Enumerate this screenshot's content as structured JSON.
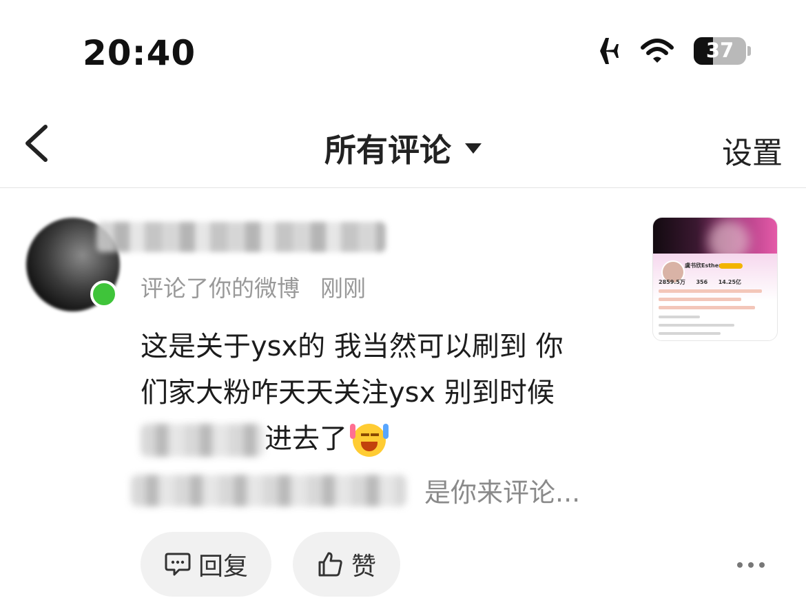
{
  "status_bar": {
    "time": "20:40",
    "battery_level": "37",
    "battery_fraction": 0.37,
    "icons": [
      "airplane-icon",
      "wifi-icon",
      "battery-icon"
    ]
  },
  "nav": {
    "title": "所有评论",
    "settings_label": "设置",
    "icons": [
      "back-chevron-icon",
      "dropdown-caret-icon"
    ]
  },
  "comment": {
    "meta_action": "评论了你的微博",
    "meta_time": "刚刚",
    "body_line1": "这是关于ysx的 我当然可以刷到 你",
    "body_line2": "们家大粉咋天天关注ysx 别到时候",
    "body_line3_tail": "进去了",
    "emoji_name": "laughing-emoji",
    "quote_tail": "是你来评论...",
    "online_color": "#3fc43a"
  },
  "thumbnail": {
    "profile_name": "虞书欣Esther",
    "stat1": "2859.5万",
    "stat2": "356",
    "stat3": "14.25亿"
  },
  "actions": {
    "reply_label": "回复",
    "like_label": "赞",
    "icons": [
      "reply-icon",
      "thumbs-up-icon",
      "more-icon"
    ]
  }
}
